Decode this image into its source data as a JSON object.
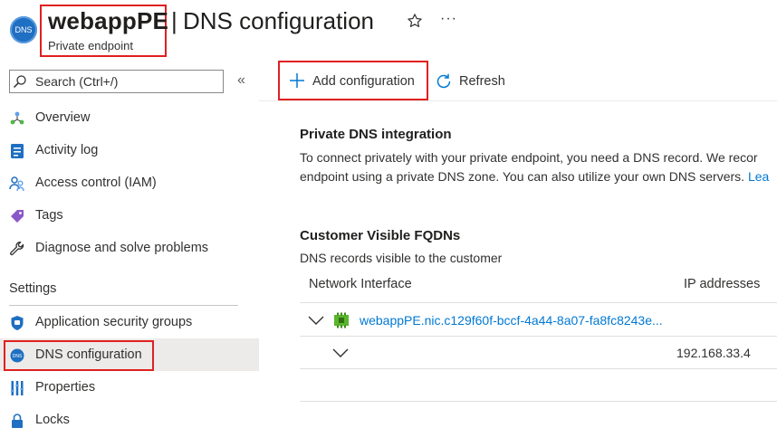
{
  "header": {
    "resource_name": "webappPE",
    "resource_type": "Private endpoint",
    "separator": "|",
    "page_title": "DNS configuration",
    "resource_icon_text": "DNS",
    "more_label": "···"
  },
  "sidebar": {
    "search_placeholder": "Search (Ctrl+/)",
    "collapse_label": "«",
    "items": [
      {
        "label": "Overview",
        "icon": "overview-icon"
      },
      {
        "label": "Activity log",
        "icon": "activity-log-icon"
      },
      {
        "label": "Access control (IAM)",
        "icon": "iam-icon"
      },
      {
        "label": "Tags",
        "icon": "tag-icon"
      },
      {
        "label": "Diagnose and solve problems",
        "icon": "wrench-icon"
      }
    ],
    "settings_title": "Settings",
    "settings_items": [
      {
        "label": "Application security groups",
        "icon": "shield-icon"
      },
      {
        "label": "DNS configuration",
        "icon": "dns-icon",
        "selected": true
      },
      {
        "label": "Properties",
        "icon": "properties-icon"
      },
      {
        "label": "Locks",
        "icon": "lock-icon"
      }
    ]
  },
  "toolbar": {
    "add_label": "Add configuration",
    "refresh_label": "Refresh"
  },
  "content": {
    "dns_heading": "Private DNS integration",
    "dns_text_line1": "To connect privately with your private endpoint, you need a DNS record. We recor",
    "dns_text_line2": "endpoint using a private DNS zone. You can also utilize your own DNS servers. ",
    "dns_link": "Lea",
    "fqdn_heading": "Customer Visible FQDNs",
    "fqdn_text": "DNS records visible to the customer",
    "columns": {
      "network_interface": "Network Interface",
      "ip_addresses": "IP addresses"
    },
    "rows": [
      {
        "nic": "webappPE.nic.c129f60f-bccf-4a44-8a07-fa8fc8243e...",
        "ip": "192.168.33.4"
      }
    ]
  },
  "colors": {
    "accent": "#0078d4",
    "highlight": "#e02020",
    "selected_bg": "#edebe9"
  }
}
